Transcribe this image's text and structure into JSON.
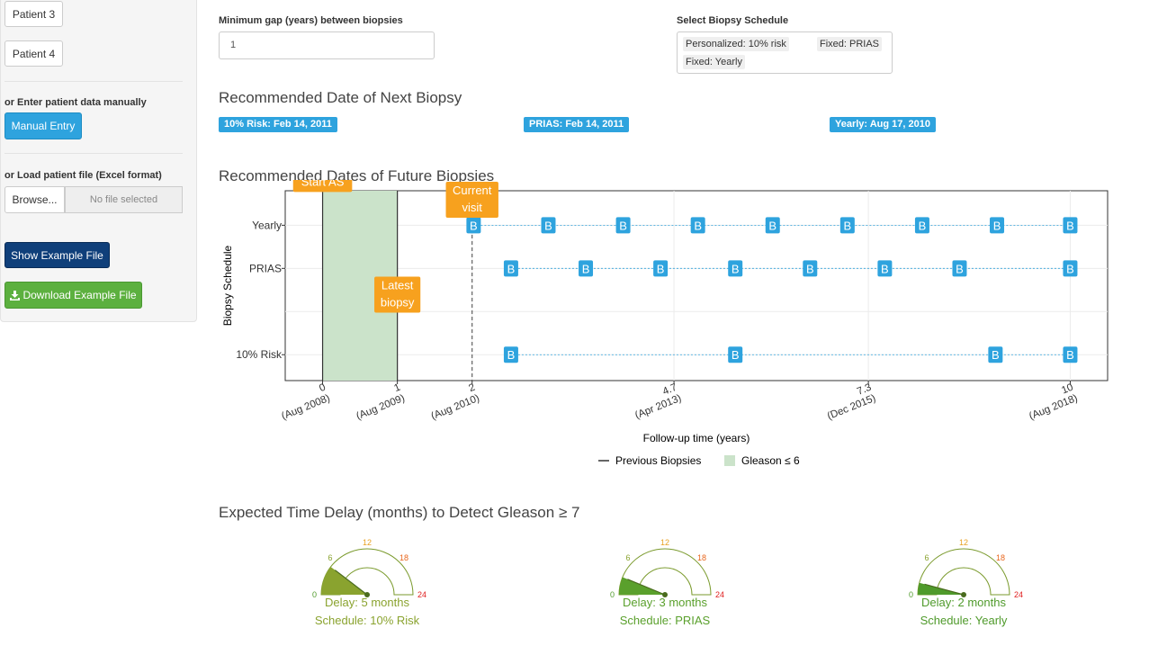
{
  "sidebar": {
    "patient3": "Patient 3",
    "patient4": "Patient 4",
    "manual_label": "or Enter patient data manually",
    "manual_button": "Manual Entry",
    "load_label": "or Load patient file (Excel format)",
    "browse_button": "Browse...",
    "file_placeholder": "No file selected",
    "show_example": "Show Example File",
    "download_example": "Download Example File",
    "download_icon": "download-icon"
  },
  "gap": {
    "label": "Minimum gap (years) between biopsies",
    "value": "1"
  },
  "schedule_select": {
    "label": "Select Biopsy Schedule",
    "selected": [
      "Personalized: 10% risk",
      "Fixed: PRIAS",
      "Fixed: Yearly"
    ]
  },
  "next_biopsy": {
    "title": "Recommended Date of Next Biopsy",
    "labels": [
      "10% Risk: Feb 14, 2011",
      "PRIAS: Feb 14, 2011",
      "Yearly: Aug 17, 2010"
    ],
    "color": "#2ea3de"
  },
  "future_biopsies": {
    "title": "Recommended Dates of Future Biopsies"
  },
  "chart_data": {
    "type": "scatter",
    "xlabel": "Follow-up time (years)",
    "ylabel": "Biopsy Schedule",
    "xlim": [
      -0.5,
      10.5
    ],
    "x_ticks": [
      {
        "value": 0,
        "label": "0",
        "date": "(Aug 2008)"
      },
      {
        "value": 1,
        "label": "1",
        "date": "(Aug 2009)"
      },
      {
        "value": 2,
        "label": "2",
        "date": "(Aug 2010)"
      },
      {
        "value": 4.7,
        "label": "4.7",
        "date": "(Apr 2013)"
      },
      {
        "value": 7.3,
        "label": "7.3",
        "date": "(Dec 2015)"
      },
      {
        "value": 10,
        "label": "10",
        "date": "(Aug 2018)"
      }
    ],
    "categories": [
      "Yearly",
      "PRIAS",
      "10% Risk"
    ],
    "category_positions": [
      3,
      2.5,
      1.5
    ],
    "ylim": [
      1.2,
      3.4
    ],
    "marker": "B",
    "series": [
      {
        "name": "Yearly",
        "x": [
          2.02,
          3.02,
          4.02,
          5.02,
          6.02,
          7.02,
          8.02,
          9.02,
          10
        ]
      },
      {
        "name": "PRIAS",
        "x": [
          2.52,
          3.52,
          4.52,
          5.52,
          6.52,
          7.52,
          8.52,
          10
        ]
      },
      {
        "name": "10% Risk",
        "x": [
          2.52,
          5.52,
          9.0,
          10
        ]
      }
    ],
    "previous_biopsies": [
      0,
      1
    ],
    "current_visit": 2,
    "gleason_region": [
      0,
      1
    ],
    "annotations": [
      {
        "text": "Start AS",
        "x": 0,
        "y": 3.5
      },
      {
        "text": [
          "Latest",
          "biopsy"
        ],
        "x": 1,
        "y": 2.3
      },
      {
        "text": [
          "Current",
          "visit"
        ],
        "x": 2,
        "y": 3.4
      }
    ],
    "legend": [
      {
        "label": "Previous Biopsies",
        "kind": "line"
      },
      {
        "label": "Gleason ≤ 6",
        "kind": "fill"
      }
    ],
    "legend_position": "bottom",
    "grid": true,
    "colors": {
      "marker": "#2ea3de",
      "annotation": "#f7a11e",
      "fill": "#cbe3ca"
    }
  },
  "delay": {
    "title": "Expected Time Delay (months) to Detect Gleason ≥ 7",
    "gauges": [
      {
        "value": 5,
        "delay_text": "Delay: 5 months",
        "schedule_text": "Schedule: 10% Risk",
        "color": "#8aa32f"
      },
      {
        "value": 3,
        "delay_text": "Delay: 3 months",
        "schedule_text": "Schedule: PRIAS",
        "color": "#5aa02c"
      },
      {
        "value": 2,
        "delay_text": "Delay: 2 months",
        "schedule_text": "Schedule: Yearly",
        "color": "#4f9a2b"
      }
    ],
    "ticks": [
      {
        "label": "0",
        "value": 0,
        "color": "#4f9a2b"
      },
      {
        "label": "6",
        "value": 6,
        "color": "#8aa32f"
      },
      {
        "label": "12",
        "value": 12,
        "color": "#e8a020"
      },
      {
        "label": "18",
        "value": 18,
        "color": "#e8651c"
      },
      {
        "label": "24",
        "value": 24,
        "color": "#e02020"
      }
    ],
    "max": 24
  }
}
